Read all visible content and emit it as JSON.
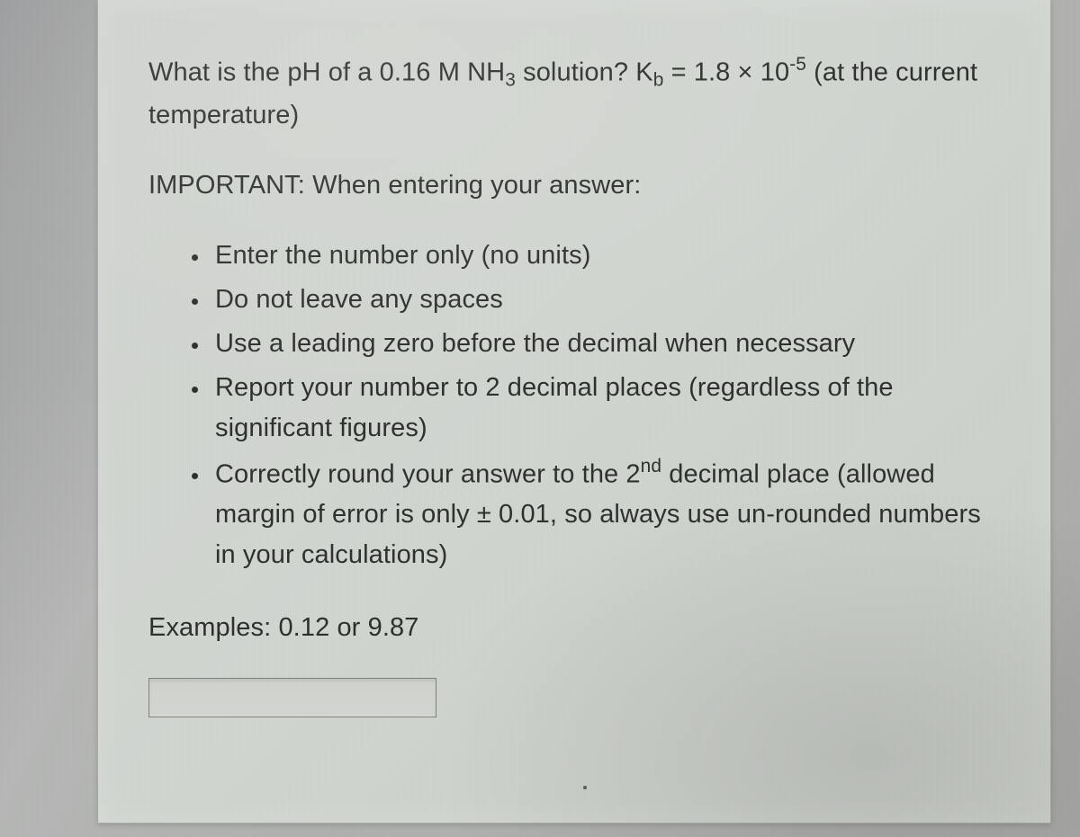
{
  "question": {
    "prefix": "What is the pH of a ",
    "concentration": "0.16",
    "unit": "M",
    "compound_base": "NH",
    "compound_sub": "3",
    "mid": " solution?  K",
    "kb_sub": "b",
    "eq": " = ",
    "kb_val": "1.8 × 10",
    "kb_exp": "-5",
    "tail": " (at the current temperature)"
  },
  "important_label": "IMPORTANT:  When entering your answer:",
  "bullets": {
    "b1": "Enter the number only (no units)",
    "b2": "Do not leave any spaces",
    "b3": "Use a leading zero before the decimal when necessary",
    "b4": "Report your number to 2 decimal places (regardless of the significant figures)",
    "b5_a": "Correctly round your answer to the 2",
    "b5_sup": "nd",
    "b5_b": " decimal place (allowed margin of error is only ± 0.01, so always use un-rounded numbers in your calculations)"
  },
  "examples": {
    "label": "Examples:  ",
    "ex1": "0.12",
    "or": "  or  ",
    "ex2": "9.87"
  },
  "answer": {
    "value": "",
    "placeholder": ""
  }
}
